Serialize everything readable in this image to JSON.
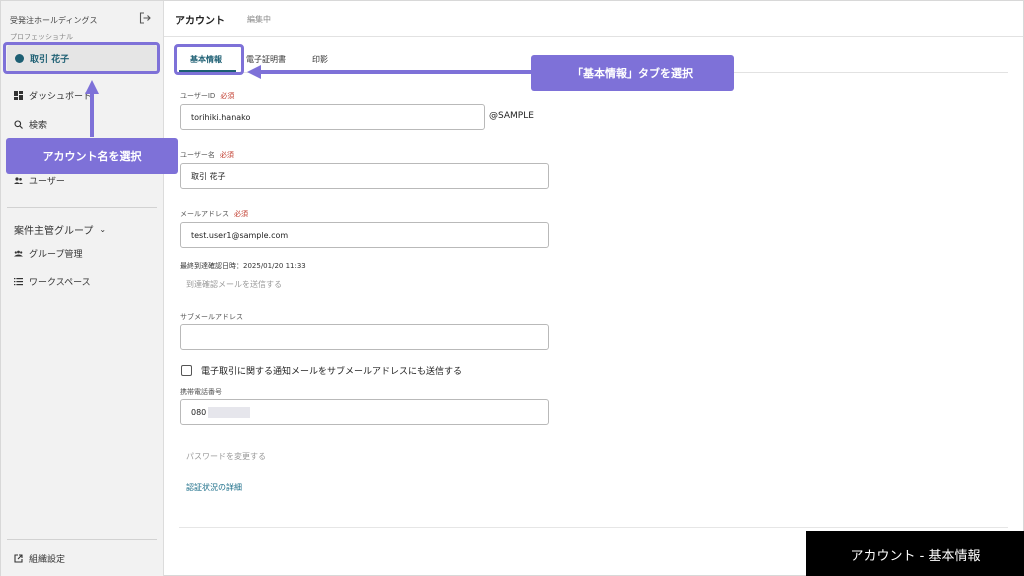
{
  "sidebar": {
    "org_name": "受発注ホールディングス",
    "plan_name": "プロフェッショナル",
    "account_name": "取引 花子",
    "items": [
      {
        "label": "ダッシュボード",
        "icon": "dashboard-icon"
      },
      {
        "label": "検索",
        "icon": "search-icon"
      },
      {
        "label": "ユーザー",
        "icon": "users-icon"
      }
    ],
    "group_title": "案件主管グループ",
    "group_items": [
      {
        "label": "グループ管理",
        "icon": "group-icon"
      },
      {
        "label": "ワークスペース",
        "icon": "list-icon"
      }
    ],
    "footer_item": {
      "label": "組織設定",
      "icon": "external-link-icon"
    }
  },
  "topbar": {
    "title": "アカウント",
    "status": "編集中"
  },
  "tabs": [
    {
      "label": "基本情報",
      "active": true
    },
    {
      "label": "電子証明書",
      "active": false
    },
    {
      "label": "印影",
      "active": false
    }
  ],
  "form": {
    "user_id": {
      "label": "ユーザーID",
      "required": "必須",
      "value": "torihiki.hanako",
      "suffix": "@SAMPLE"
    },
    "user_name": {
      "label": "ユーザー名",
      "required": "必須",
      "value": "取引 花子"
    },
    "email": {
      "label": "メールアドレス",
      "required": "必須",
      "value": "test.user1@sample.com"
    },
    "last_confirmed": "最終到達確認日時：2025/01/20 11:33",
    "send_confirm_link": "到達確認メールを送信する",
    "sub_email": {
      "label": "サブメールアドレス",
      "value": ""
    },
    "notify_checkbox": "電子取引に関する通知メールをサブメールアドレスにも送信する",
    "phone": {
      "label": "携帯電話番号",
      "value": "080"
    },
    "change_password_link": "パスワードを変更する",
    "auth_status_link": "認証状況の詳細"
  },
  "annotations": {
    "account_callout": "アカウント名を選択",
    "tab_callout": "「基本情報」タブを選択",
    "accent_color": "#7e71d8"
  },
  "caption": "アカウント - 基本情報"
}
